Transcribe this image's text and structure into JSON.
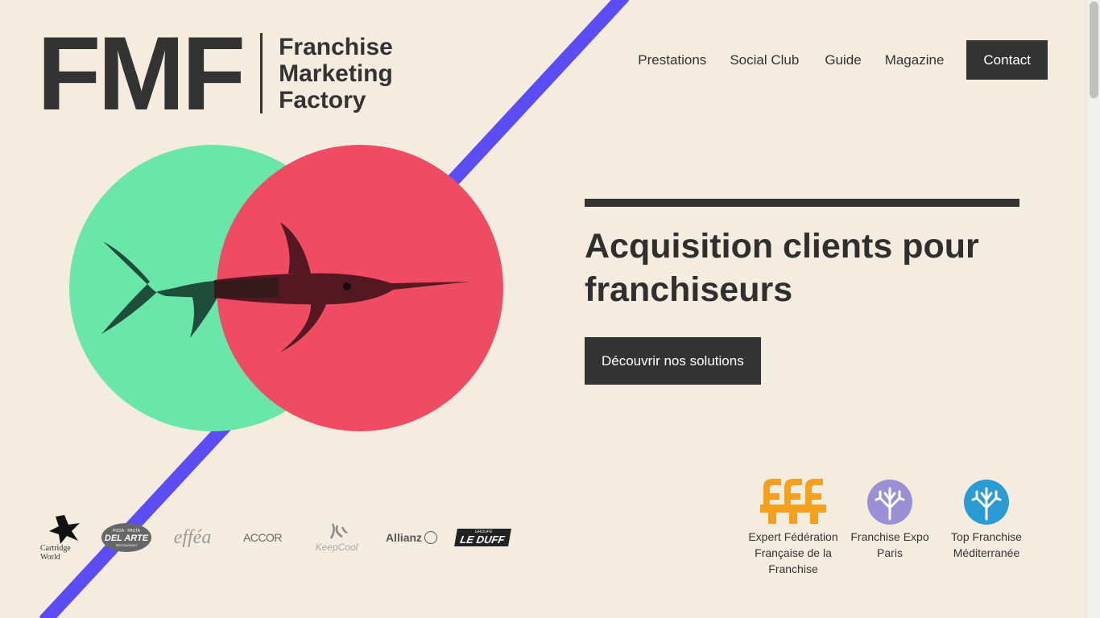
{
  "logo": {
    "mark": "FMF",
    "line1": "Franchise",
    "line2": "Marketing",
    "line3": "Factory"
  },
  "nav": {
    "items": [
      "Prestations",
      "Social Club",
      "Guide",
      "Magazine"
    ],
    "contact": "Contact"
  },
  "hero": {
    "title": "Acquisition clients pour franchiseurs",
    "cta": "Découvrir nos solutions"
  },
  "clients": [
    {
      "name": "Cartridge World",
      "icon": "cartridge-world-logo"
    },
    {
      "name": "DEL ARTE",
      "icon": "del-arte-logo",
      "sub_top": "PIZZA · PASTA",
      "sub_bottom": "RESTAURANT"
    },
    {
      "name": "efféa",
      "icon": "effea-logo"
    },
    {
      "name": "ACCOR",
      "icon": "accor-logo"
    },
    {
      "name": "KeepCool",
      "icon": "keepcool-logo"
    },
    {
      "name": "Allianz",
      "icon": "allianz-logo"
    },
    {
      "name": "LE DUFF",
      "icon": "le-duff-logo",
      "sub": "GROUPE"
    }
  ],
  "badges": [
    {
      "line1": "Expert Fédération",
      "line2": "Française de la Franchise",
      "icon": "fff-logo",
      "color": "#f7a01d"
    },
    {
      "line1": "Franchise Expo",
      "line2": "Paris",
      "icon": "tree-icon",
      "color": "#9b8fd6"
    },
    {
      "line1": "Top Franchise",
      "line2": "Méditerranée",
      "icon": "tree-icon",
      "color": "#2b9bd6"
    }
  ],
  "colors": {
    "background": "#f5ece0",
    "stripe": "#5b4cf5",
    "green_circle": "#6be6aa",
    "red_circle": "#ef4b63",
    "dark": "#333333"
  }
}
